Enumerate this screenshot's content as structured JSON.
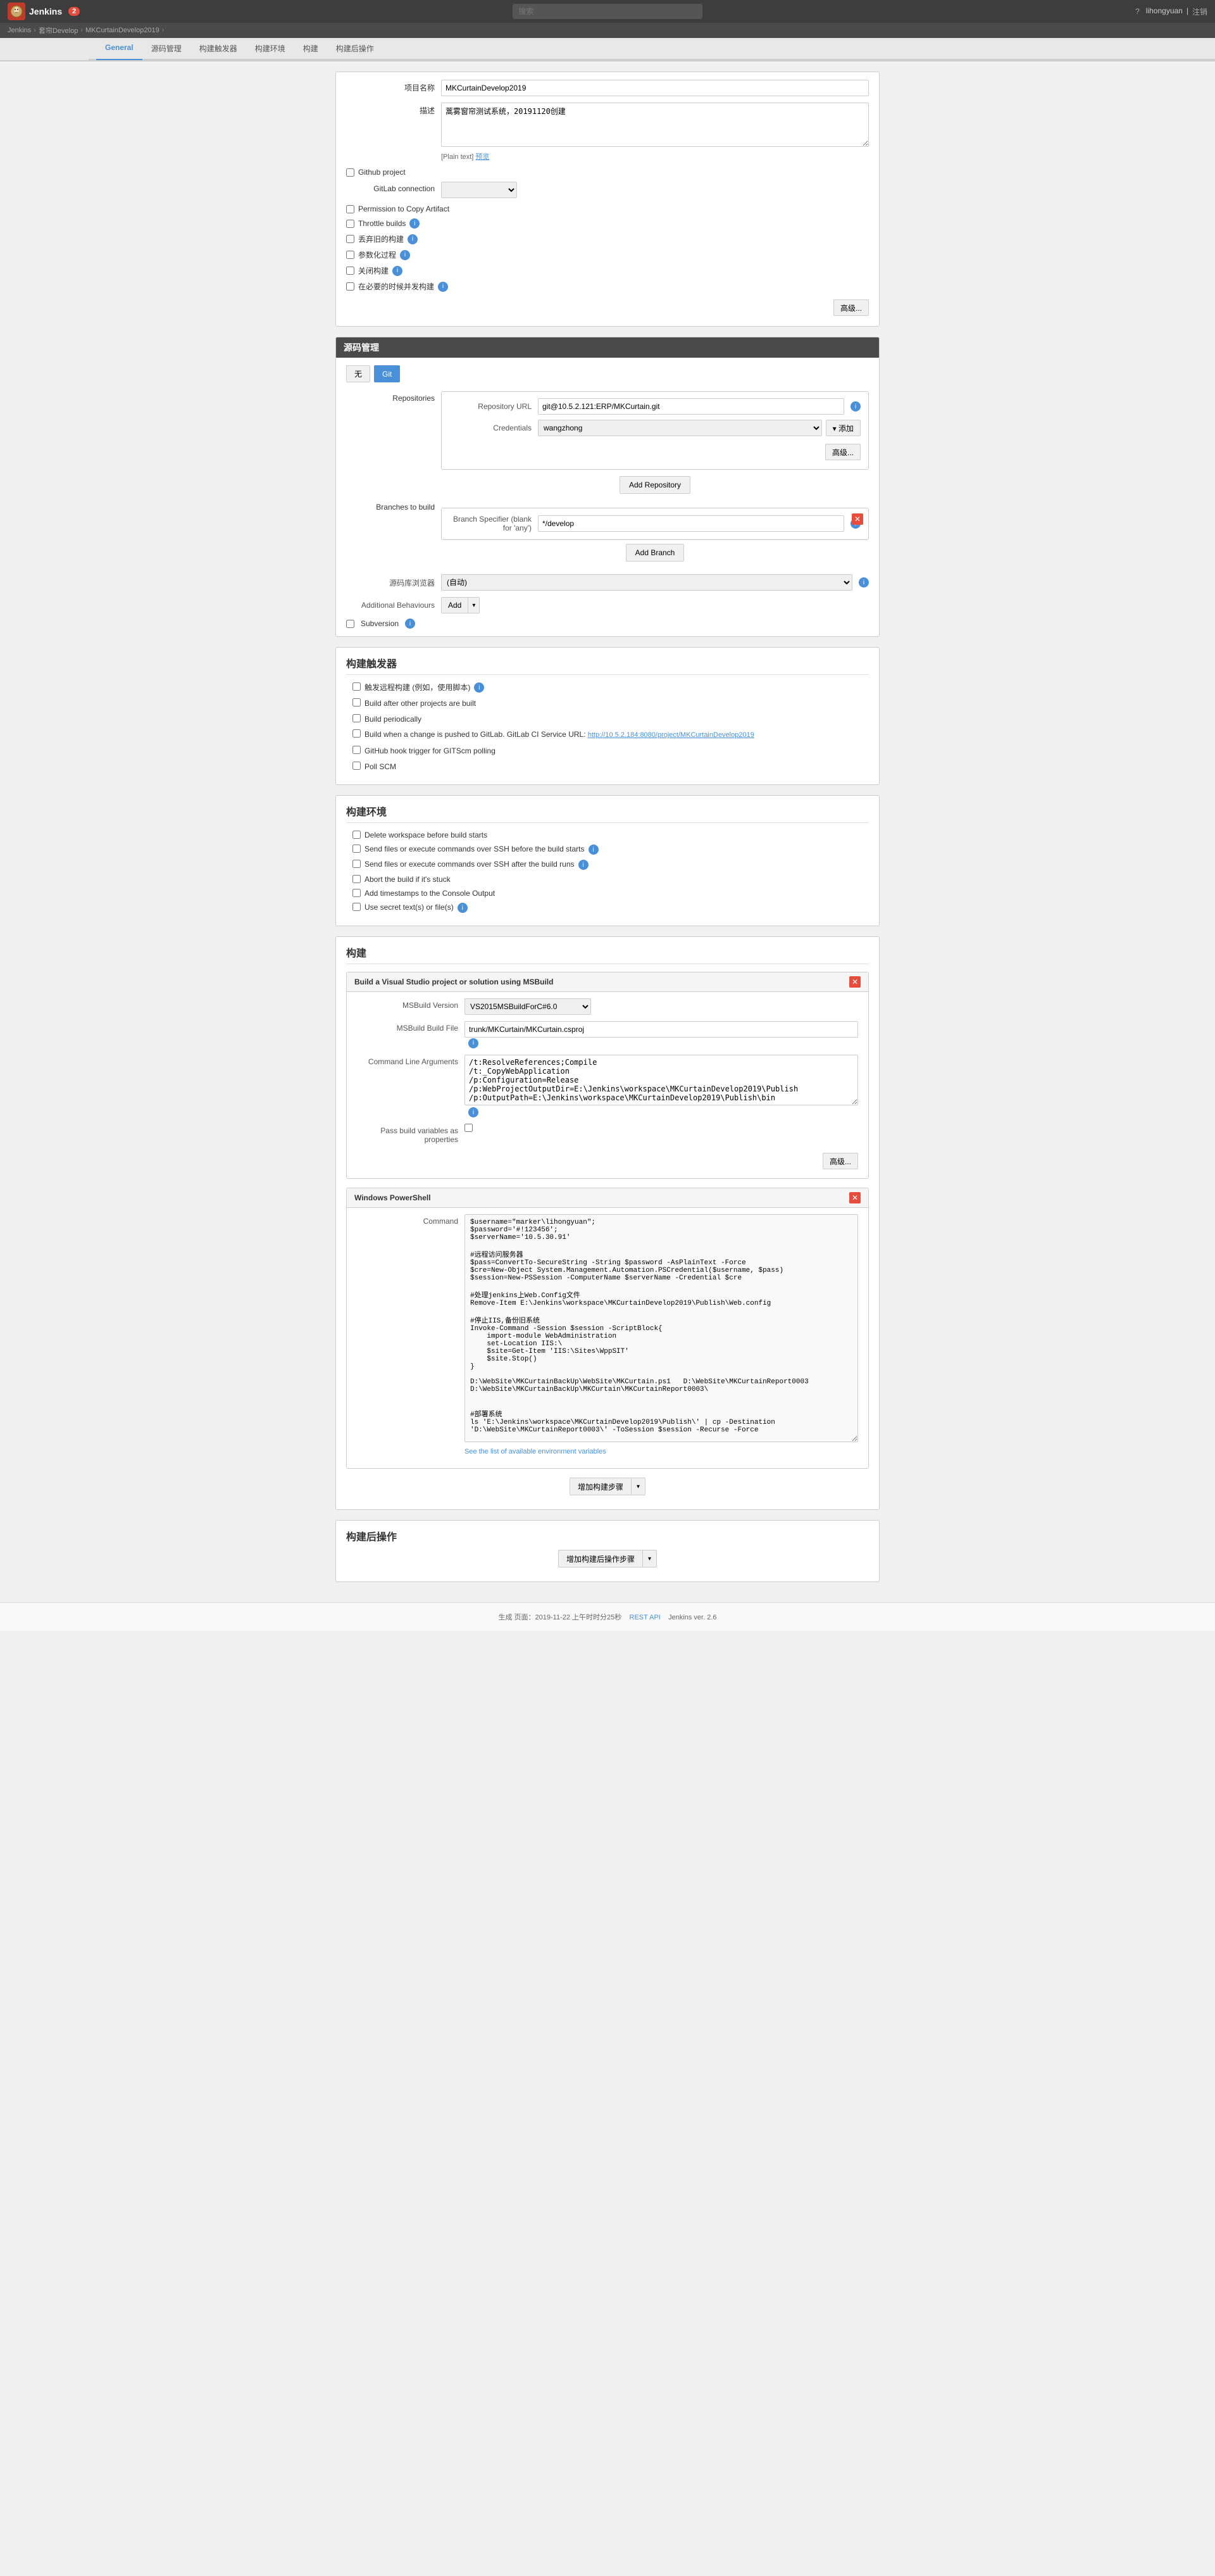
{
  "header": {
    "logo_text": "Jenkins",
    "badge_count": "2",
    "search_placeholder": "搜索",
    "user_icon": "?",
    "username": "lihongyuan",
    "logout_label": "注销"
  },
  "breadcrumb": {
    "items": [
      "Jenkins",
      "套帘Develop",
      "MKCurtainDevelop2019",
      ""
    ]
  },
  "tabs": {
    "items": [
      "General",
      "源码管理",
      "构建触发器",
      "构建环境",
      "构建",
      "构建后操作"
    ]
  },
  "general": {
    "section": "General",
    "project_name_label": "项目名称",
    "project_name_value": "MKCurtainDevelop2019",
    "description_label": "描述",
    "description_value": "蒿雾窗帘测试系统，20191120创建",
    "plain_text": "[Plain text]",
    "rich_text": "预览",
    "github_project_label": "Github project",
    "gitlab_connection_label": "GitLab connection",
    "gitlab_connection_value": "",
    "permission_copy_label": "Permission to Copy Artifact",
    "throttle_builds_label": "Throttle builds",
    "disable_build_label": "丢弃旧的构建",
    "parameterize_label": "参数化过程",
    "concurrent_build_label": "关闭构建",
    "necessary_build_label": "在必要的时候并发构建",
    "advanced_btn": "高级..."
  },
  "source_control": {
    "title": "源码管理",
    "scm_options": [
      "无",
      "Git"
    ],
    "selected_scm": "Git",
    "repositories_label": "Repositories",
    "repository_url_label": "Repository URL",
    "repository_url_value": "git@10.5.2.121:ERP/MKCurtain.git",
    "credentials_label": "Credentials",
    "credentials_value": "wangzhong",
    "add_btn": "添加",
    "advanced_btn": "高级...",
    "add_repository_btn": "Add Repository",
    "branches_label": "Branches to build",
    "branch_specifier_label": "Branch Specifier (blank for 'any')",
    "branch_specifier_value": "*/develop",
    "add_branch_btn": "Add Branch",
    "repo_browser_label": "源码库浏览器",
    "repo_browser_value": "(自动)",
    "additional_behaviours_label": "Additional Behaviours",
    "add_label": "Add",
    "subversion_label": "Subversion"
  },
  "build_triggers": {
    "title": "构建触发器",
    "triggers": [
      {
        "label": "触发远程构建 (例如，使用脚本)",
        "checked": false,
        "has_info": true
      },
      {
        "label": "Build after other projects are built",
        "checked": false,
        "has_info": false
      },
      {
        "label": "Build periodically",
        "checked": false,
        "has_info": false
      },
      {
        "label": "Build when a change is pushed to GitLab. GitLab CI Service URL: http://10.5.2.184:8080/project/MKCurtainDevelop2019",
        "checked": false,
        "has_info": false
      },
      {
        "label": "GitHub hook trigger for GITScm polling",
        "checked": false,
        "has_info": false
      },
      {
        "label": "Poll SCM",
        "checked": false,
        "has_info": false
      }
    ]
  },
  "build_environment": {
    "title": "构建环境",
    "options": [
      {
        "label": "Delete workspace before build starts",
        "checked": false,
        "has_info": false
      },
      {
        "label": "Send files or execute commands over SSH before the build starts",
        "checked": false,
        "has_info": true
      },
      {
        "label": "Send files or execute commands over SSH after the build runs",
        "checked": false,
        "has_info": true
      },
      {
        "label": "Abort the build if it's stuck",
        "checked": false,
        "has_info": false
      },
      {
        "label": "Add timestamps to the Console Output",
        "checked": false,
        "has_info": false
      },
      {
        "label": "Use secret text(s) or file(s)",
        "checked": false,
        "has_info": true
      }
    ]
  },
  "build": {
    "title": "构建",
    "steps": [
      {
        "title": "Build a Visual Studio project or solution using MSBuild",
        "fields": [
          {
            "label": "MSBuild Version",
            "type": "select",
            "value": "VS2015MSBuildForC#6.0"
          },
          {
            "label": "MSBuild Build File",
            "type": "input",
            "value": "trunk/MKCurtain/MKCurtain.csproj"
          },
          {
            "label": "Command Line Arguments",
            "type": "textarea",
            "value": "/t:ResolveReferences;Compile\n/t:_CopyWebApplication\n/p:Configuration=Release\n/p:WebProjectOutputDir=E:\\Jenkins\\workspace\\MKCurtainDevelop2019\\Publish\n/p:OutputPath=E:\\Jenkins\\workspace\\MKCurtainDevelop2019\\Publish\\bin"
          }
        ],
        "pass_build_label": "Pass build variables as properties",
        "pass_build_checked": false,
        "advanced_btn": "高级..."
      },
      {
        "title": "Windows PowerShell",
        "fields": [
          {
            "label": "Command",
            "type": "command",
            "value": "$username=\"marker\\lihongyuan\";\n$password='#!123456';\n$serverName='10.5.30.91'\n\n#远程访问服务器\n$pass=ConvertTo-SecureString -String $password -AsPlainText -Force\n$cre=New-Object System.Management.Automation.PSCredential($username, $pass)\n$session=New-PSSession -ComputerName $serverName -Credential $cre\n\n#处理jenkins上Web.Config文件\nRemove-Item E:\\Jenkins\\workspace\\MKCurtainDevelop2019\\Publish\\Web.config\n\n#停止IIS,备份旧系统\nInvoke-Command -Session $session -ScriptBlock{\n    import-module WebAdministration\n    set-Location IIS:\\\n    $site=Get-Item 'IIS:\\Sites\\WppSIT'\n    $site.Stop()\n}\n\nD:\\WebSite\\MKCurtainBackUp\\WebSite\\MKCurtain.ps1   D:\\WebSite\\MKCurtainReport0003\nD:\\WebSite\\MKCurtainBackUp\\MKCurtain\\MKCurtainReport0003\\\n\n\n#部署系统\nls 'E:\\Jenkins\\workspace\\MKCurtainDevelop2019\\Publish\\' | cp -Destination 'D:\\WebSite\\MKCurtainReport0003\\' -ToSession $session -Recurse -Force\n\n#启开IIS\nInvoke-Command -Session $session -ScriptBlock{\n    import-module WebAdministration\n    set-location IIS:\\\n    $site=Get-Item 'IIS:\\Sites\\WppSIT'\n    $site.Start()\n}\n\nRemove-PSSession -Id $session.Id #使用完毕后一定注释掉PSselon"
          }
        ],
        "env_var_link": "See the list of available environment variables"
      }
    ],
    "add_build_step_label": "增加构建步骤"
  },
  "post_build": {
    "title": "构建后操作",
    "add_btn": "增加构建后操作步骤"
  },
  "footer": {
    "generated": "生成 页面：2019-11-22 上午时时分25秒",
    "rest_api": "REST API",
    "jenkins_version": "Jenkins ver. 2.6"
  }
}
